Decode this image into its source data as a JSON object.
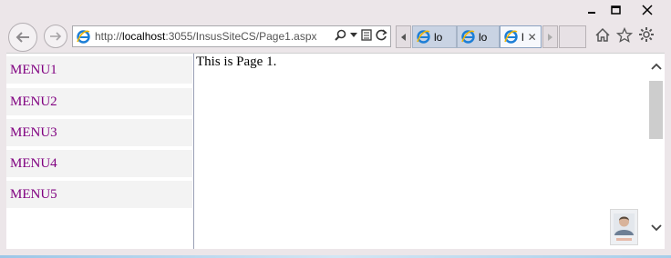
{
  "window": {
    "controls": {
      "minimize_icon": "minimize-icon",
      "maximize_icon": "maximize-icon",
      "close_icon": "close-icon"
    }
  },
  "nav": {
    "back_icon": "back-arrow-icon",
    "forward_icon": "forward-arrow-icon"
  },
  "address": {
    "url_prefix": "http://",
    "url_host": "localhost",
    "url_rest": ":3055/InsusSiteCS/Page1.aspx",
    "icons": [
      "search-icon",
      "chevron-down-icon",
      "compatibility-view-icon",
      "refresh-icon"
    ]
  },
  "tabs": [
    {
      "label": "lo"
    },
    {
      "label": "lo"
    },
    {
      "label": "l",
      "active": true
    }
  ],
  "toolbar_icons": [
    "home-icon",
    "favorites-star-icon",
    "settings-gear-icon"
  ],
  "menu": {
    "items": [
      {
        "label": "MENU1"
      },
      {
        "label": "MENU2"
      },
      {
        "label": "MENU3"
      },
      {
        "label": "MENU4"
      },
      {
        "label": "MENU5"
      }
    ],
    "link_color": "#800080"
  },
  "page": {
    "text": "This is Page 1."
  }
}
